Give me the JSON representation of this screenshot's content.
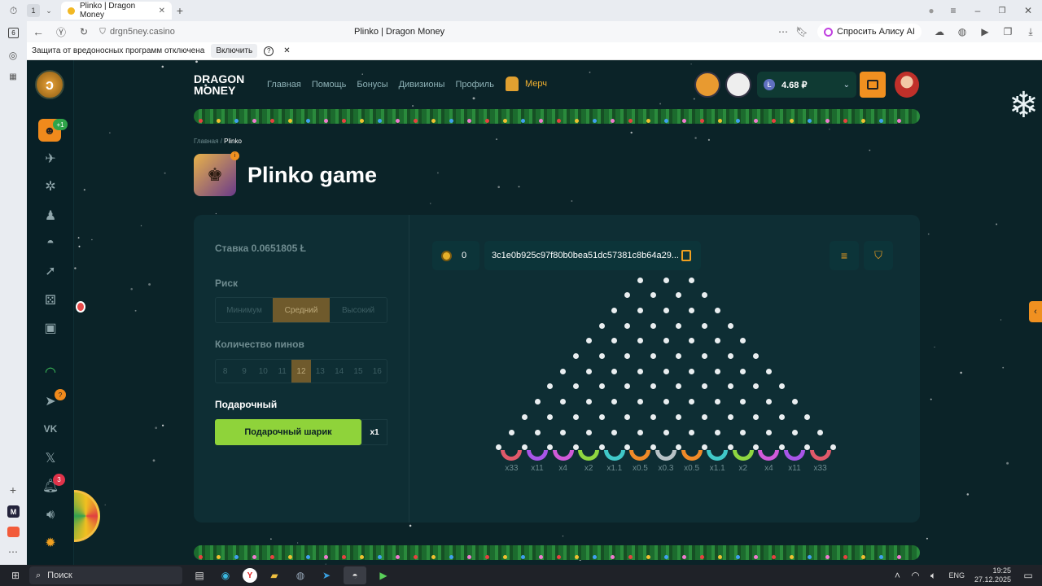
{
  "browser": {
    "tab_count": "1",
    "tab_title": "Plinko | Dragon Money",
    "url": "drgn5ney.casino",
    "page_title": "Plinko | Dragon Money",
    "alice_label": "Спросить Алису AI",
    "side_badge": "6",
    "warning_text": "Защита от вредоносных программ отключена",
    "warning_button": "Включить"
  },
  "site": {
    "logo_top": "DRAGON",
    "logo_bottom": "MONEY",
    "nav": [
      "Главная",
      "Помощь",
      "Бонусы",
      "Дивизионы",
      "Профиль"
    ],
    "merch": "Мерч",
    "balance": "4.68 ₽",
    "rail_badge_top": "+1",
    "rail_badge_help": "?",
    "rail_badge_notif": "3",
    "breadcrumb_home": "Главная",
    "breadcrumb_current": "Plinko",
    "game_title": "Plinko game"
  },
  "left": {
    "stake_label": "Ставка 0.0651805 Ł",
    "risk_label": "Риск",
    "risk_options": [
      "Минимум",
      "Средний",
      "Высокий"
    ],
    "risk_selected": "Средний",
    "pins_label": "Количество пинов",
    "pins_options": [
      "8",
      "9",
      "10",
      "11",
      "12",
      "13",
      "14",
      "15",
      "16"
    ],
    "pins_selected": "12",
    "gift_label": "Подарочный",
    "gift_button": "Подарочный шарик",
    "gift_count": "x1"
  },
  "board": {
    "coins": "0",
    "hash": "3c1e0b925c97f80b0bea51dc57381c8b64a29...",
    "rows": 12,
    "multipliers": [
      "x33",
      "x11",
      "x4",
      "x2",
      "x1.1",
      "x0.5",
      "x0.3",
      "x0.5",
      "x1.1",
      "x2",
      "x4",
      "x11",
      "x33"
    ],
    "bucket_colors": [
      "#e0596a",
      "#a855e8",
      "#d05ad8",
      "#8ed640",
      "#40c8c8",
      "#f08a28",
      "#b8c2c6",
      "#f08a28",
      "#40c8c8",
      "#8ed640",
      "#d05ad8",
      "#a855e8",
      "#e0596a"
    ]
  },
  "taskbar": {
    "search_label": "Поиск",
    "lang": "ENG",
    "time": "19:25",
    "date": "27.12.2025"
  }
}
